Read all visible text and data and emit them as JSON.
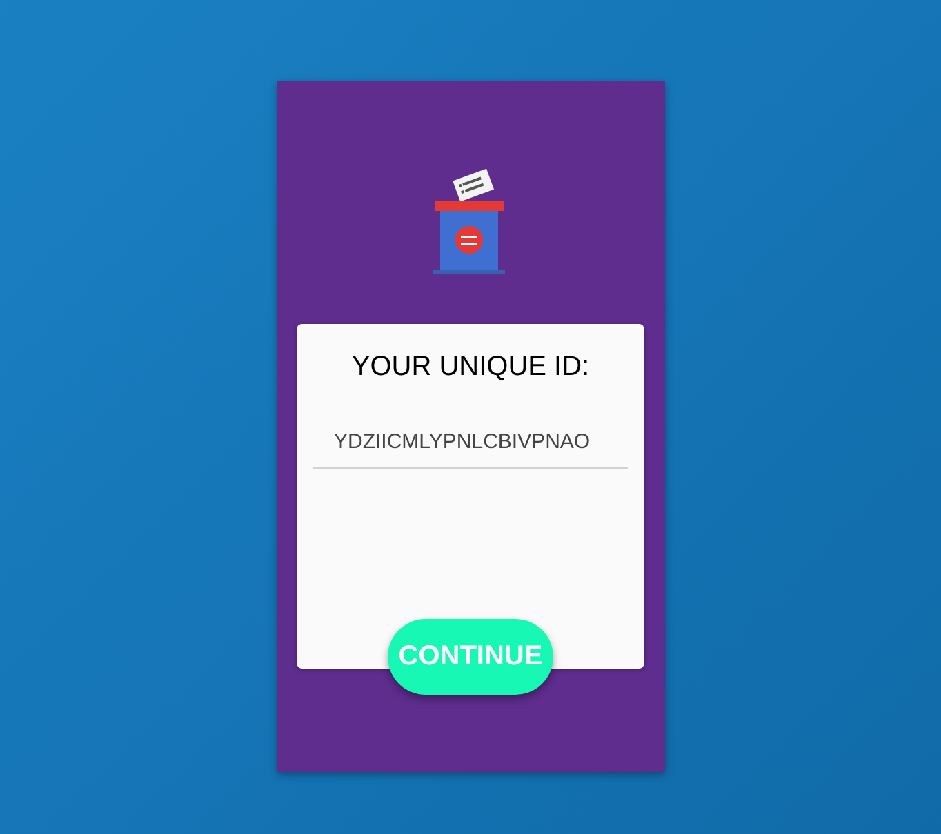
{
  "card": {
    "title": "YOUR UNIQUE ID:",
    "id_field": {
      "value": "YDZIICMLYPNLCBIVPNAO"
    }
  },
  "button": {
    "label": "CONTINUE"
  }
}
